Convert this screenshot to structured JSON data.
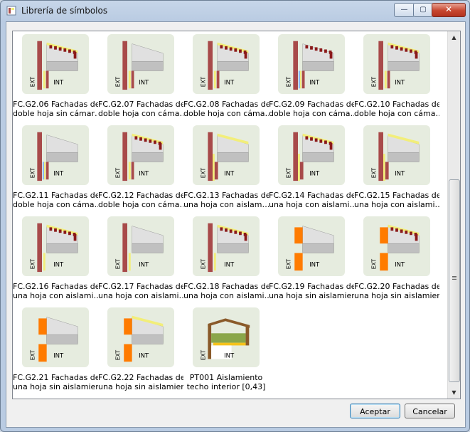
{
  "window": {
    "title": "Librería de símbolos"
  },
  "controls": {
    "minimize": "—",
    "maximize": "▢",
    "close": "✕"
  },
  "scrollbar": {
    "up": "▲",
    "down": "▼"
  },
  "items": [
    {
      "label1": "FC.G2.06 Fachadas de",
      "label2": "doble hoja sin cámar…",
      "ext": "EXT",
      "int": "INT"
    },
    {
      "label1": "FC.G2.07 Fachadas de",
      "label2": "doble hoja con cáma…",
      "ext": "EXT",
      "int": "INT"
    },
    {
      "label1": "FC.G2.08 Fachadas de",
      "label2": "doble hoja con cáma…",
      "ext": "EXT",
      "int": "INT"
    },
    {
      "label1": "FC.G2.09 Fachadas de",
      "label2": "doble hoja con cáma…",
      "ext": "EXT",
      "int": "INT"
    },
    {
      "label1": "FC.G2.10 Fachadas de",
      "label2": "doble hoja con cáma…",
      "ext": "EXT",
      "int": "INT"
    },
    {
      "label1": "FC.G2.11 Fachadas de",
      "label2": "doble hoja con cáma…",
      "ext": "EXT",
      "int": "INT"
    },
    {
      "label1": "FC.G2.12 Fachadas de",
      "label2": "doble hoja con cáma…",
      "ext": "EXT",
      "int": "INT"
    },
    {
      "label1": "FC.G2.13 Fachadas de",
      "label2": "una hoja con aislam…",
      "ext": "EXT",
      "int": "INT"
    },
    {
      "label1": "FC.G2.14 Fachadas de",
      "label2": "una hoja con aislami…",
      "ext": "EXT",
      "int": "INT"
    },
    {
      "label1": "FC.G2.15 Fachadas de",
      "label2": "una hoja con aislami…",
      "ext": "EXT",
      "int": "INT"
    },
    {
      "label1": "FC.G2.16 Fachadas de",
      "label2": "una hoja con aislami…",
      "ext": "EXT",
      "int": "INT"
    },
    {
      "label1": "FC.G2.17 Fachadas de",
      "label2": "una hoja con aislami…",
      "ext": "EXT",
      "int": "INT"
    },
    {
      "label1": "FC.G2.18 Fachadas de",
      "label2": "una hoja con aislami…",
      "ext": "EXT",
      "int": "INT"
    },
    {
      "label1": "FC.G2.19 Fachadas de",
      "label2": "una hoja sin aislamiento",
      "ext": "EXT",
      "int": "INT"
    },
    {
      "label1": "FC.G2.20 Fachadas de",
      "label2": "una hoja sin aislamiento",
      "ext": "EXT",
      "int": "INT"
    },
    {
      "label1": "FC.G2.21 Fachadas de",
      "label2": "una hoja sin aislamiento",
      "ext": "EXT",
      "int": "INT"
    },
    {
      "label1": "FC.G2.22 Fachadas de",
      "label2": "una hoja sin aislamiento",
      "ext": "EXT",
      "int": "INT"
    },
    {
      "label1": "PT001 Aislamiento",
      "label2": "techo interior [0,43]",
      "ext": "EXT",
      "int": "INT"
    }
  ],
  "buttons": {
    "accept": "Aceptar",
    "cancel": "Cancelar"
  },
  "colors": {
    "wall": "#a84a4a",
    "insulation": "#f2ee7a",
    "roof": "#8b1a1a",
    "slab": "#c0c0c0",
    "orange_wall": "#ff7b00",
    "green_panel": "#8aa64a",
    "thumb_bg": "#e6ecdf"
  }
}
